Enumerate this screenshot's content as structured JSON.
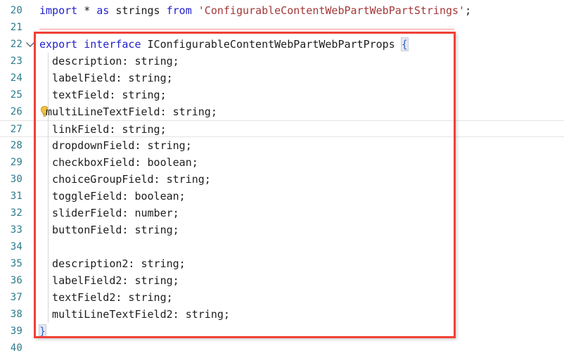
{
  "editor": {
    "app": "code-editor",
    "language": "TypeScript",
    "font_size_px": 15,
    "colors": {
      "background": "#ffffff",
      "line_number": "#2b7b8c",
      "keyword": "#2222cc",
      "string": "#a33838",
      "plain_text": "#1c1c1c",
      "brace": "#3b62c9",
      "annotation_red": "#ef4136",
      "current_line_border": "#e4e4e4",
      "indent_guide": "#d7d7d7",
      "lightbulb": "#f2c13c"
    },
    "current_line": 27,
    "annotation": {
      "name": "red-highlight-rectangle",
      "color": "#ef4136",
      "covers_lines": "22-39"
    },
    "lines": [
      {
        "number": "20",
        "fold": false,
        "bulb": false,
        "current": false,
        "tokens": [
          {
            "t": "import",
            "c": "kw"
          },
          {
            "t": " * ",
            "c": "op"
          },
          {
            "t": "as",
            "c": "kw"
          },
          {
            "t": " strings ",
            "c": "type"
          },
          {
            "t": "from",
            "c": "kw"
          },
          {
            "t": " ",
            "c": "op"
          },
          {
            "t": "'ConfigurableContentWebPartWebPartStrings'",
            "c": "str"
          },
          {
            "t": ";",
            "c": "op"
          }
        ]
      },
      {
        "number": "21",
        "fold": false,
        "bulb": false,
        "current": false,
        "tokens": []
      },
      {
        "number": "22",
        "fold": true,
        "bulb": false,
        "current": false,
        "tokens": [
          {
            "t": "export",
            "c": "kw"
          },
          {
            "t": " ",
            "c": "op"
          },
          {
            "t": "interface",
            "c": "kw"
          },
          {
            "t": " IConfigurableContentWebPartWebPartProps ",
            "c": "type"
          },
          {
            "t": "{",
            "c": "brace-hl"
          }
        ]
      },
      {
        "number": "23",
        "fold": false,
        "bulb": false,
        "current": false,
        "tokens": [
          {
            "t": "  description: string;",
            "c": "type"
          }
        ]
      },
      {
        "number": "24",
        "fold": false,
        "bulb": false,
        "current": false,
        "tokens": [
          {
            "t": "  labelField: string;",
            "c": "type"
          }
        ]
      },
      {
        "number": "25",
        "fold": false,
        "bulb": false,
        "current": false,
        "tokens": [
          {
            "t": "  textField: string;",
            "c": "type"
          }
        ]
      },
      {
        "number": "26",
        "fold": false,
        "bulb": true,
        "current": false,
        "tokens": [
          {
            "t": " multiLineTextField: string;",
            "c": "type"
          }
        ]
      },
      {
        "number": "27",
        "fold": false,
        "bulb": false,
        "current": true,
        "tokens": [
          {
            "t": "  linkField: string;",
            "c": "type"
          }
        ]
      },
      {
        "number": "28",
        "fold": false,
        "bulb": false,
        "current": false,
        "tokens": [
          {
            "t": "  dropdownField: string;",
            "c": "type"
          }
        ]
      },
      {
        "number": "29",
        "fold": false,
        "bulb": false,
        "current": false,
        "tokens": [
          {
            "t": "  checkboxField: boolean;",
            "c": "type"
          }
        ]
      },
      {
        "number": "30",
        "fold": false,
        "bulb": false,
        "current": false,
        "tokens": [
          {
            "t": "  choiceGroupField: string;",
            "c": "type"
          }
        ]
      },
      {
        "number": "31",
        "fold": false,
        "bulb": false,
        "current": false,
        "tokens": [
          {
            "t": "  toggleField: boolean;",
            "c": "type"
          }
        ]
      },
      {
        "number": "32",
        "fold": false,
        "bulb": false,
        "current": false,
        "tokens": [
          {
            "t": "  sliderField: number;",
            "c": "type"
          }
        ]
      },
      {
        "number": "33",
        "fold": false,
        "bulb": false,
        "current": false,
        "tokens": [
          {
            "t": "  buttonField: string;",
            "c": "type"
          }
        ]
      },
      {
        "number": "34",
        "fold": false,
        "bulb": false,
        "current": false,
        "tokens": []
      },
      {
        "number": "35",
        "fold": false,
        "bulb": false,
        "current": false,
        "tokens": [
          {
            "t": "  description2: string;",
            "c": "type"
          }
        ]
      },
      {
        "number": "36",
        "fold": false,
        "bulb": false,
        "current": false,
        "tokens": [
          {
            "t": "  labelField2: string;",
            "c": "type"
          }
        ]
      },
      {
        "number": "37",
        "fold": false,
        "bulb": false,
        "current": false,
        "tokens": [
          {
            "t": "  textField2: string;",
            "c": "type"
          }
        ]
      },
      {
        "number": "38",
        "fold": false,
        "bulb": false,
        "current": false,
        "tokens": [
          {
            "t": "  multiLineTextField2: string;",
            "c": "type"
          }
        ]
      },
      {
        "number": "39",
        "fold": false,
        "bulb": false,
        "current": false,
        "tokens": [
          {
            "t": "}",
            "c": "brace-hl"
          }
        ]
      },
      {
        "number": "40",
        "fold": false,
        "bulb": false,
        "current": false,
        "tokens": []
      }
    ]
  }
}
